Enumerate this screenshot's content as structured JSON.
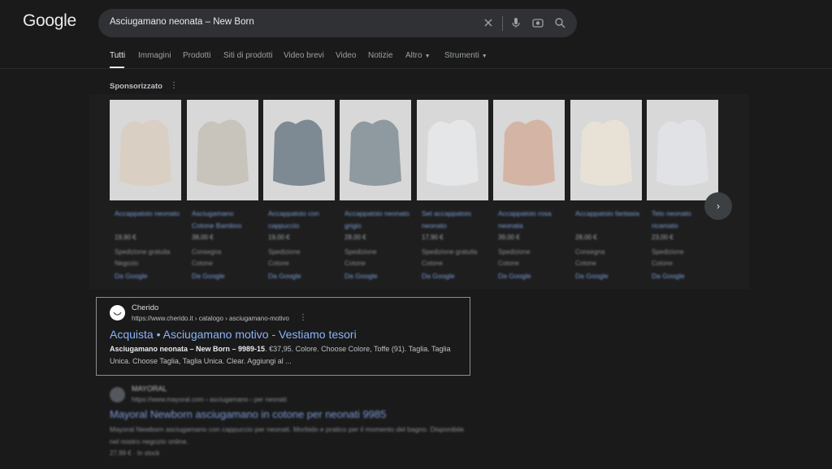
{
  "logo": "Google",
  "search": {
    "query": "Asciugamano neonata – New Born"
  },
  "icons": {
    "clear": "close-icon",
    "voice": "mic-icon",
    "lens": "camera-lens-icon",
    "search": "search-icon"
  },
  "tabs": [
    "Tutti",
    "Immagini",
    "Prodotti",
    "Siti di prodotti",
    "Video brevi",
    "Video",
    "Notizie",
    "Altro",
    "Strumenti"
  ],
  "sponsored": {
    "label": "Sponsorizzato"
  },
  "products": [
    {
      "title": "Accappatoio neonato",
      "price": "19,90 €",
      "ship": "Spedizione gratuita",
      "store": "Negozio",
      "more": "Da Google",
      "color": "#d9cfc3"
    },
    {
      "title": "Asciugamano Cotone Bamboo",
      "price": "38,00 €",
      "ship": "Consegna",
      "store": "Cotone",
      "more": "Da Google",
      "color": "#c8c4bc"
    },
    {
      "title": "Accappatoio con cappuccio",
      "price": "19,00 €",
      "ship": "Spedizione",
      "store": "Cotone",
      "more": "Da Google",
      "color": "#7e8a93"
    },
    {
      "title": "Accappatoio neonato grigio",
      "price": "28,00 €",
      "ship": "Spedizione",
      "store": "Cotone",
      "more": "Da Google",
      "color": "#8f9aa0"
    },
    {
      "title": "Set accappatoio neonato",
      "price": "17,90 €",
      "ship": "Spedizione gratuita",
      "store": "Cotone",
      "more": "Da Google",
      "color": "#e4e6e8"
    },
    {
      "title": "Accappatoio rosa neonata",
      "price": "39,00 €",
      "ship": "Spedizione",
      "store": "Cotone",
      "more": "Da Google",
      "color": "#d4b5a5"
    },
    {
      "title": "Accappatoio fantasia",
      "price": "28,00 €",
      "ship": "Consegna",
      "store": "Cotone",
      "more": "Da Google",
      "color": "#e8e2d6"
    },
    {
      "title": "Telo neonato ricamato",
      "price": "23,00 €",
      "ship": "Spedizione",
      "store": "Cotone",
      "more": "Da Google",
      "color": "#e1e2e6"
    }
  ],
  "result1": {
    "site": "Cherido",
    "url": "https://www.cherido.it › catalogo › asciugamano-motivo",
    "title": "Acquista • Asciugamano motivo - Vestiamo tesori",
    "snippet_bold": "Asciugamano neonata – New Born – 9989-15",
    "snippet": ". €37,95. Colore. Choose Colore, Toffe (91). Taglia. Taglia Unica. Choose Taglia, Taglia Unica. Clear. Aggiungi al ..."
  },
  "result2": {
    "site": "MAYORAL",
    "url": "https://www.mayoral.com › asciugamano › per neonati",
    "title": "Mayoral Newborn asciugamano in cotone per neonati 9985",
    "snippet": "Mayoral Newborn asciugamano con cappuccio per neonati. Morbido e pratico per il momento del bagno. Disponibile nel nostro negozio online.",
    "meta": "27,99 € · In stock"
  }
}
